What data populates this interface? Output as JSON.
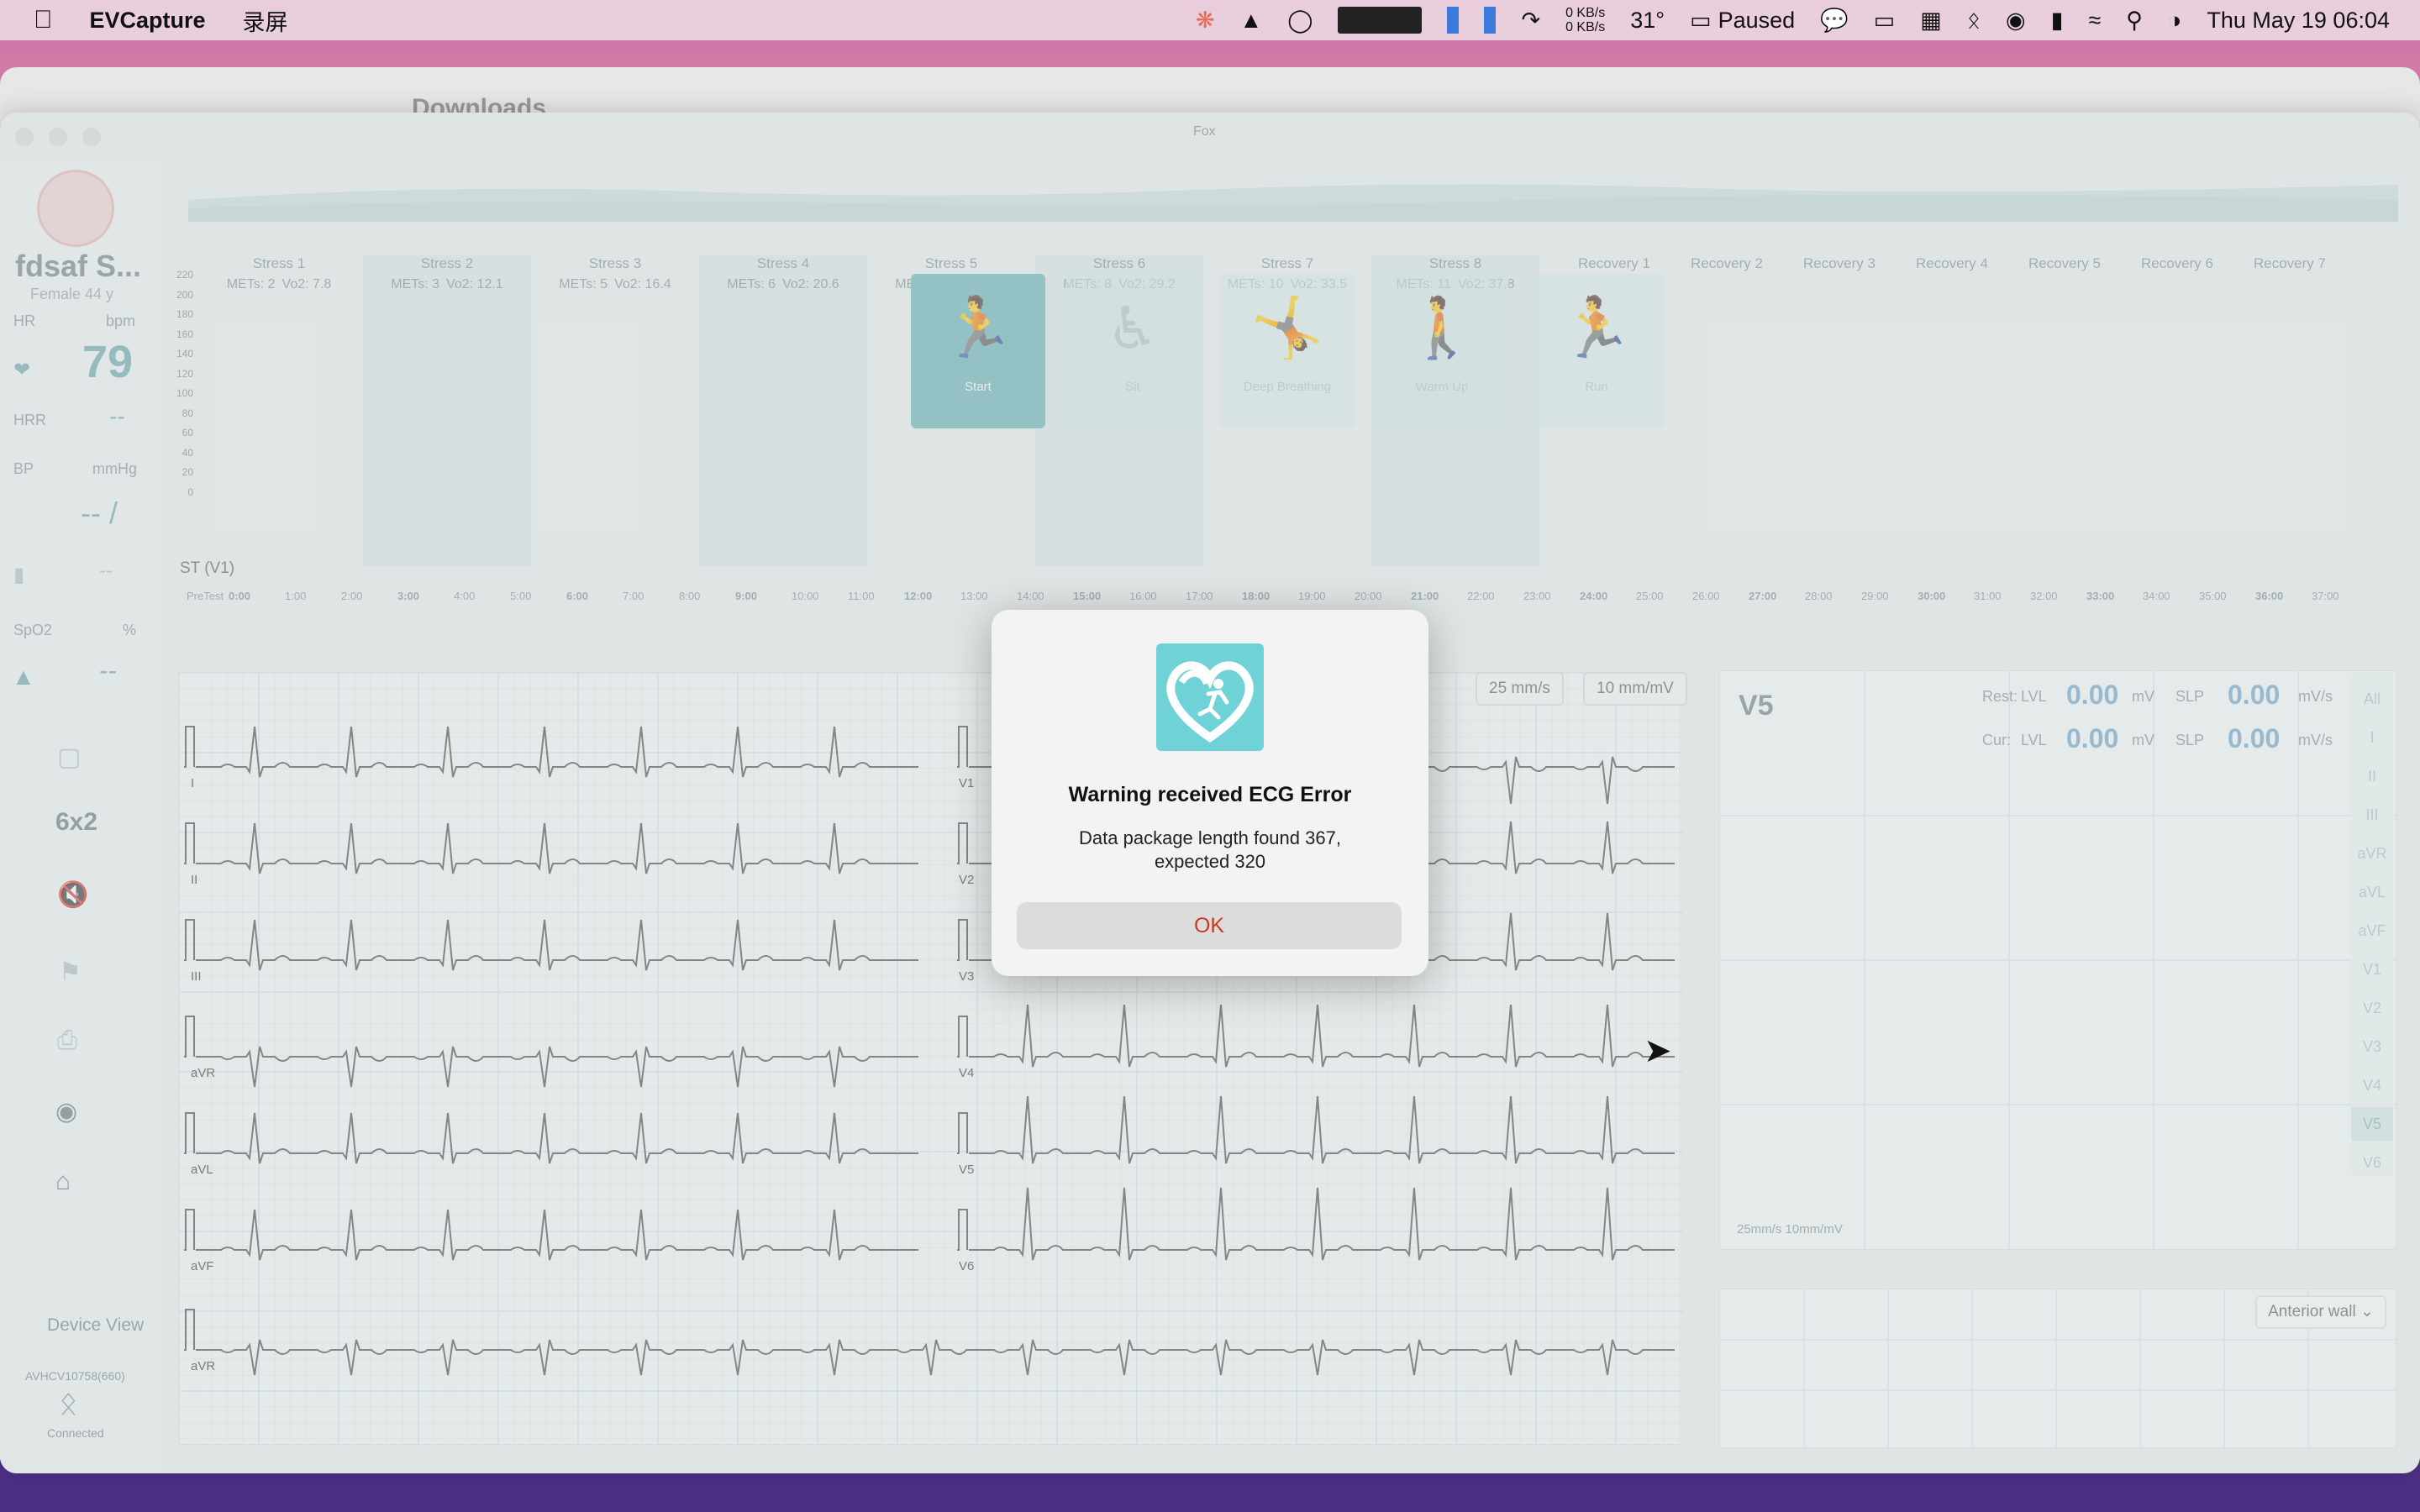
{
  "menubar": {
    "app": "EVCapture",
    "menu1": "录屏",
    "net_up": "0 KB/s",
    "net_down": "0 KB/s",
    "temp": "31°",
    "status": "Paused",
    "datetime": "Thu May 19  06:04"
  },
  "finder": {
    "title": "Downloads"
  },
  "window": {
    "title": "Fox"
  },
  "patient": {
    "name": "fdsaf S...",
    "sub": "Female 44 y"
  },
  "vitals": {
    "hr_label": "HR",
    "hr_unit": "bpm",
    "hr_value": "79",
    "hrr_label": "HRR",
    "hrr_value": "--",
    "bp_label": "BP",
    "bp_unit": "mmHg",
    "bp_value": "-- /",
    "spo2_label": "SpO2",
    "spo2_unit": "%",
    "spo2_value": "--",
    "misc_value": "--"
  },
  "sidebar": {
    "layout": "6x2",
    "device_view": "Device View",
    "device_id": "AVHCV10758(660)",
    "connected": "Connected"
  },
  "stages": [
    {
      "name": "Stress 1",
      "mets": "METs: 2",
      "vo2": "Vo2: 7.8"
    },
    {
      "name": "Stress 2",
      "mets": "METs: 3",
      "vo2": "Vo2: 12.1"
    },
    {
      "name": "Stress 3",
      "mets": "METs: 5",
      "vo2": "Vo2: 16.4"
    },
    {
      "name": "Stress 4",
      "mets": "METs: 6",
      "vo2": "Vo2: 20.6"
    },
    {
      "name": "Stress 5",
      "mets": "METs: 7",
      "vo2": "Vo2: 24.9"
    },
    {
      "name": "Stress 6",
      "mets": "METs: 8",
      "vo2": "Vo2: 29.2"
    },
    {
      "name": "Stress 7",
      "mets": "METs: 10",
      "vo2": "Vo2: 33.5"
    },
    {
      "name": "Stress 8",
      "mets": "METs: 11",
      "vo2": "Vo2: 37.8"
    }
  ],
  "recovery": [
    "Recovery 1",
    "Recovery 2",
    "Recovery 3",
    "Recovery 4",
    "Recovery 5",
    "Recovery 6",
    "Recovery 7"
  ],
  "yaxis": [
    "220",
    "200",
    "180",
    "160",
    "140",
    "120",
    "100",
    "80",
    "60",
    "40",
    "20",
    "0"
  ],
  "timeaxis": [
    "PreTest",
    "0:00",
    "1:00",
    "2:00",
    "3:00",
    "4:00",
    "5:00",
    "6:00",
    "7:00",
    "8:00",
    "9:00",
    "10:00",
    "11:00",
    "12:00",
    "13:00",
    "14:00",
    "15:00",
    "16:00",
    "17:00",
    "18:00",
    "19:00",
    "20:00",
    "21:00",
    "22:00",
    "23:00",
    "24:00",
    "25:00",
    "26:00",
    "27:00",
    "28:00",
    "29:00",
    "30:00",
    "31:00",
    "32:00",
    "33:00",
    "34:00",
    "35:00",
    "36:00",
    "37:00"
  ],
  "exercise": [
    {
      "label": "Start"
    },
    {
      "label": "Sit"
    },
    {
      "label": "Deep Breathing"
    },
    {
      "label": "Warm Up"
    },
    {
      "label": "Run"
    }
  ],
  "st_label": "ST (V1)",
  "leads_left": [
    "I",
    "II",
    "III",
    "aVR",
    "aVL",
    "aVF"
  ],
  "leads_right": [
    "V1",
    "V2",
    "V3",
    "V4",
    "V5",
    "V6"
  ],
  "rhythm_lead": "aVR",
  "speed": "25 mm/s",
  "gain": "10 mm/mV",
  "panel": {
    "lead": "V5",
    "rest": "Rest:",
    "cur": "Cur:",
    "lvl": "LVL",
    "slp": "SLP",
    "rest_lvl": "0.00",
    "rest_slp": "0.00",
    "cur_lvl": "0.00",
    "cur_slp": "0.00",
    "unit_mv": "mV",
    "unit_mvs": "mV/s",
    "footer": "25mm/s  10mm/mV"
  },
  "leadlist": [
    "All",
    "I",
    "II",
    "III",
    "aVR",
    "aVL",
    "aVF",
    "V1",
    "V2",
    "V3",
    "V4",
    "V5",
    "V6"
  ],
  "wall": "Anterior wall",
  "dialog": {
    "title": "Warning received ECG Error",
    "message": "Data package length found 367, expected 320",
    "ok": "OK"
  },
  "colors": {
    "teal": "#72b5b8",
    "ok_red": "#c83a1e",
    "logo_bg": "#6fd2d6"
  }
}
